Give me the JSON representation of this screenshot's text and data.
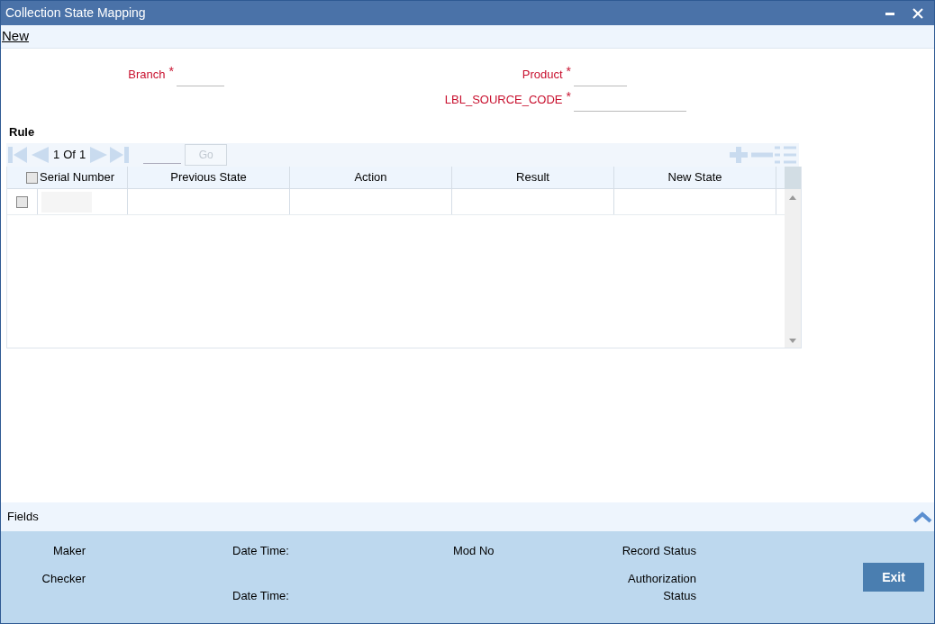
{
  "window": {
    "title": "Collection State Mapping"
  },
  "toolbar": [
    "New"
  ],
  "form": {
    "fields": [
      {
        "label": "Branch",
        "required_mark": "*"
      },
      {
        "label": "Product",
        "required_mark": "*"
      },
      {
        "label": "LBL_SOURCE_CODE",
        "required_mark": "*"
      }
    ]
  },
  "grid": {
    "title": "Rule",
    "pager": {
      "current": "1",
      "of": "Of",
      "total": "1",
      "go": "Go",
      "go_disabled": true
    },
    "columns": [
      "Serial Number",
      "Previous State",
      "Action",
      "Result",
      "New State"
    ],
    "header_checked": false,
    "rows": [
      {
        "checked": false
      }
    ]
  },
  "footer": {
    "title": "Fields",
    "audit": [
      {
        "labels": [
          "Maker",
          "Checker"
        ]
      },
      {
        "labels": [
          "Date Time:",
          "Date Time:"
        ]
      },
      {
        "labels": [
          "Mod No"
        ]
      },
      {
        "labels": [
          "Record Status",
          "Authorization Status"
        ]
      }
    ],
    "exit": "Exit"
  }
}
